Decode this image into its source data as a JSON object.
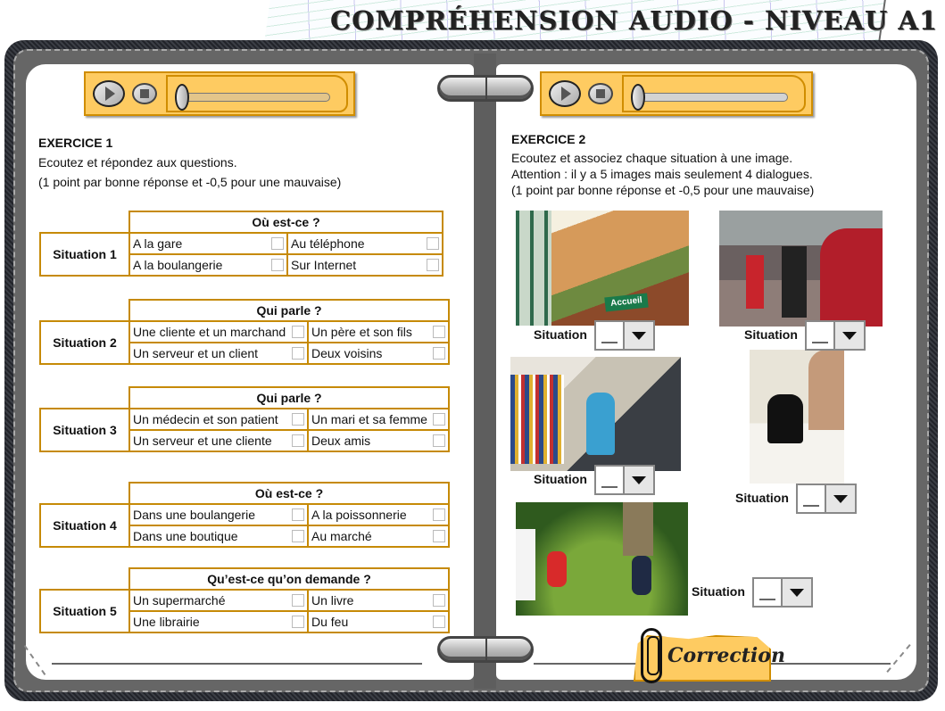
{
  "header": {
    "title": "COMPRÉHENSION AUDIO - NIVEAU A1"
  },
  "colors": {
    "accent": "#fecb61",
    "accent_border": "#c68a06",
    "binder": "#666666"
  },
  "players": [
    {
      "icons": [
        "play-icon",
        "stop-icon"
      ],
      "progress": 0
    },
    {
      "icons": [
        "play-icon",
        "stop-icon"
      ],
      "progress": 0
    }
  ],
  "exercise1": {
    "title": "EXERCICE 1",
    "instruction": "Ecoutez et répondez aux questions.",
    "scoring": "(1 point par bonne réponse et -0,5 pour une mauvaise)",
    "situations": [
      {
        "label": "Situation 1",
        "question": "Où est-ce ?",
        "options": [
          "A la gare",
          "Au téléphone",
          "A la boulangerie",
          "Sur Internet"
        ]
      },
      {
        "label": "Situation 2",
        "question": "Qui parle ?",
        "options": [
          "Une cliente et un marchand",
          "Un père et son fils",
          "Un serveur et un client",
          "Deux voisins"
        ]
      },
      {
        "label": "Situation 3",
        "question": "Qui parle ?",
        "options": [
          "Un médecin et son patient",
          "Un mari et sa femme",
          "Un serveur et une cliente",
          "Deux amis"
        ]
      },
      {
        "label": "Situation 4",
        "question": "Où est-ce ?",
        "options": [
          "Dans une boulangerie",
          "A la poissonnerie",
          "Dans une boutique",
          "Au marché"
        ]
      },
      {
        "label": "Situation 5",
        "question": "Qu’est-ce qu’on demande ?",
        "options": [
          "Un supermarché",
          "Un livre",
          "Une librairie",
          "Du feu"
        ]
      }
    ]
  },
  "exercise2": {
    "title": "EXERCICE 2",
    "instruction": "Ecoutez et associez chaque situation à une image.",
    "attention": "Attention : il y a 5 images mais seulement 4 dialogues.",
    "scoring": "(1 point par bonne réponse et -0,5 pour une mauvaise)",
    "images": [
      {
        "name": "photo-reception-desk",
        "sign_text": "Accueil",
        "label": "Situation",
        "selected": "__"
      },
      {
        "name": "photo-street-band",
        "label": "Situation",
        "selected": "__"
      },
      {
        "name": "photo-library",
        "label": "Situation",
        "selected": "__"
      },
      {
        "name": "photo-teacher-student",
        "label": "Situation",
        "selected": "__"
      },
      {
        "name": "photo-picnic-group",
        "label": "Situation",
        "selected": "__"
      }
    ]
  },
  "correction_button": {
    "label": "Correction"
  }
}
